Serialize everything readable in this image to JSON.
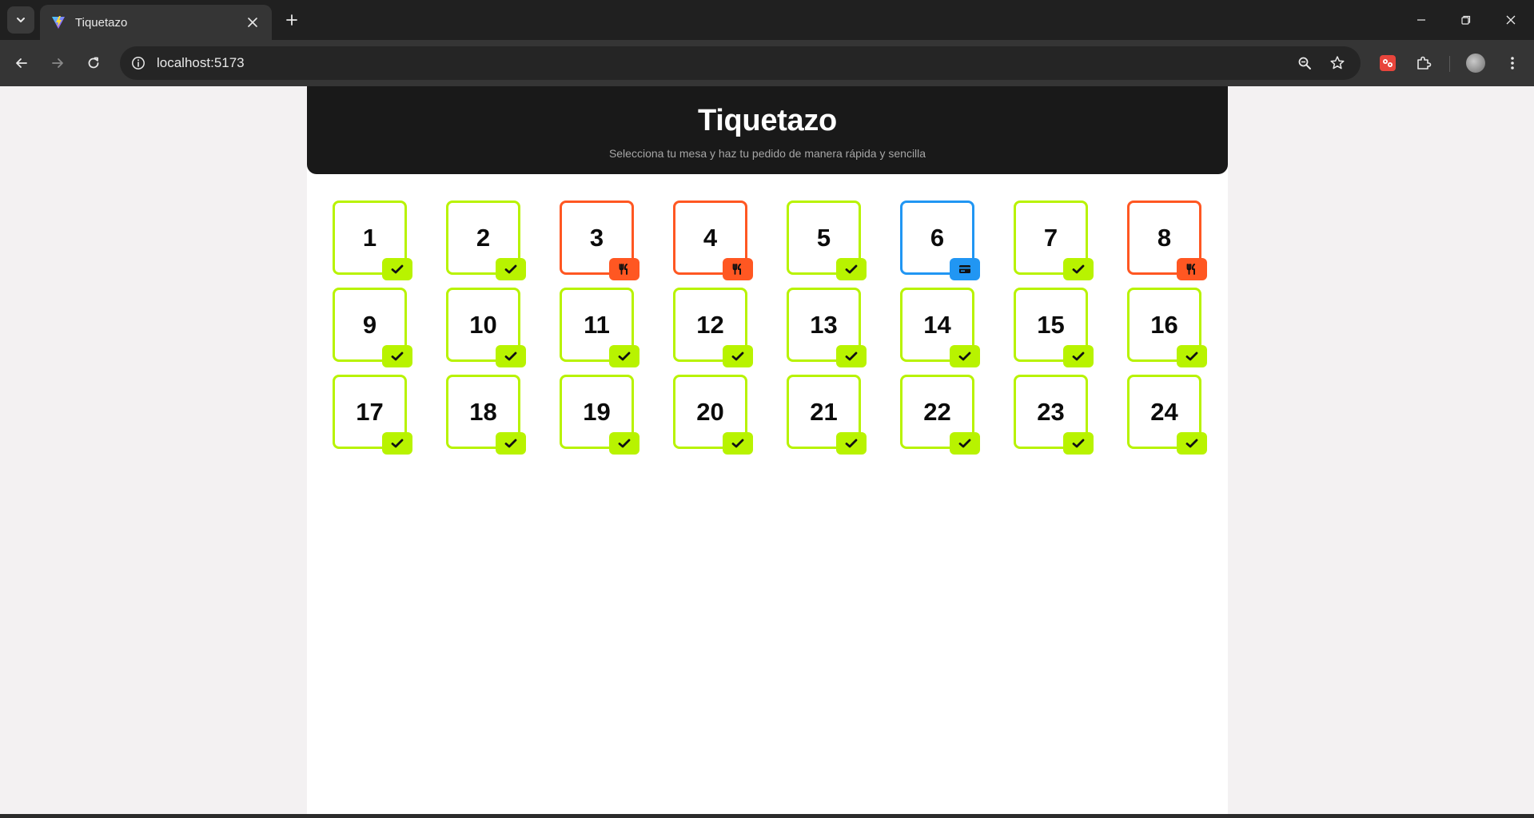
{
  "browser": {
    "tab_title": "Tiquetazo",
    "url": "localhost:5173"
  },
  "header": {
    "title": "Tiquetazo",
    "subtitle": "Selecciona tu mesa y haz tu pedido de manera rápida y sencilla"
  },
  "colors": {
    "free": "#b8f300",
    "occupied": "#ff5722",
    "paying": "#2196f3",
    "header_bg": "#191919"
  },
  "tables": [
    {
      "number": "1",
      "status": "free",
      "icon": "check-icon"
    },
    {
      "number": "2",
      "status": "free",
      "icon": "check-icon"
    },
    {
      "number": "3",
      "status": "occupied",
      "icon": "utensils-icon"
    },
    {
      "number": "4",
      "status": "occupied",
      "icon": "utensils-icon"
    },
    {
      "number": "5",
      "status": "free",
      "icon": "check-icon"
    },
    {
      "number": "6",
      "status": "paying",
      "icon": "credit-card-icon"
    },
    {
      "number": "7",
      "status": "free",
      "icon": "check-icon"
    },
    {
      "number": "8",
      "status": "occupied",
      "icon": "utensils-icon"
    },
    {
      "number": "9",
      "status": "free",
      "icon": "check-icon"
    },
    {
      "number": "10",
      "status": "free",
      "icon": "check-icon"
    },
    {
      "number": "11",
      "status": "free",
      "icon": "check-icon"
    },
    {
      "number": "12",
      "status": "free",
      "icon": "check-icon"
    },
    {
      "number": "13",
      "status": "free",
      "icon": "check-icon"
    },
    {
      "number": "14",
      "status": "free",
      "icon": "check-icon"
    },
    {
      "number": "15",
      "status": "free",
      "icon": "check-icon"
    },
    {
      "number": "16",
      "status": "free",
      "icon": "check-icon"
    },
    {
      "number": "17",
      "status": "free",
      "icon": "check-icon"
    },
    {
      "number": "18",
      "status": "free",
      "icon": "check-icon"
    },
    {
      "number": "19",
      "status": "free",
      "icon": "check-icon"
    },
    {
      "number": "20",
      "status": "free",
      "icon": "check-icon"
    },
    {
      "number": "21",
      "status": "free",
      "icon": "check-icon"
    },
    {
      "number": "22",
      "status": "free",
      "icon": "check-icon"
    },
    {
      "number": "23",
      "status": "free",
      "icon": "check-icon"
    },
    {
      "number": "24",
      "status": "free",
      "icon": "check-icon"
    }
  ]
}
